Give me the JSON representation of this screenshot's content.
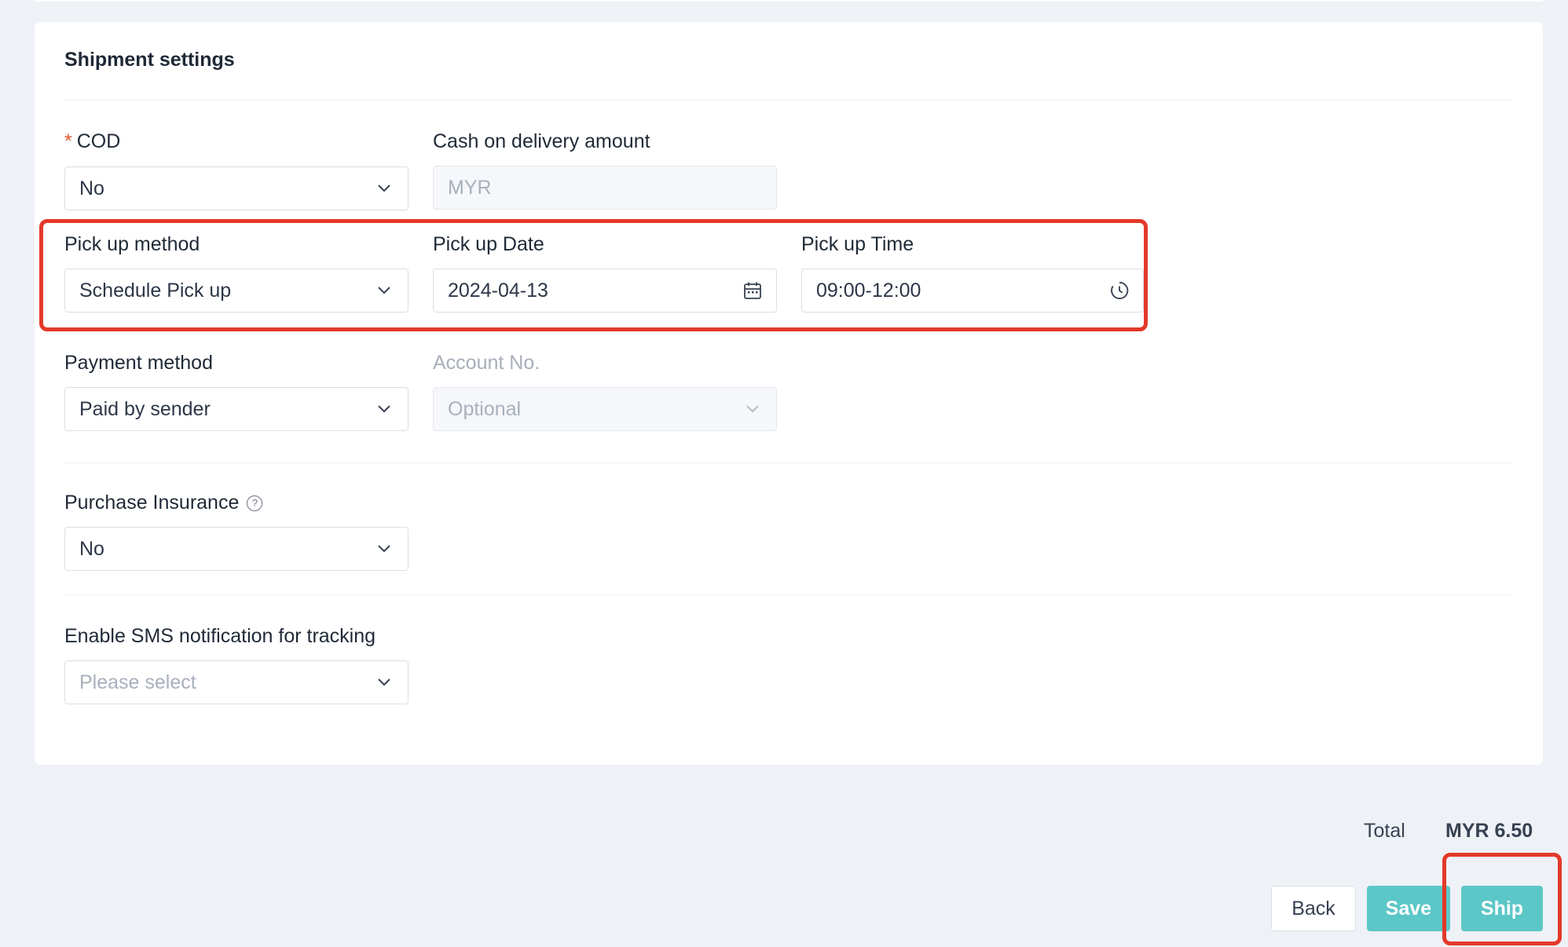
{
  "section": {
    "title": "Shipment settings"
  },
  "cod": {
    "label": "COD",
    "required_mark": "*",
    "value": "No"
  },
  "cod_amount": {
    "label": "Cash on delivery amount",
    "placeholder": "MYR"
  },
  "pickup_method": {
    "label": "Pick up method",
    "value": "Schedule Pick up"
  },
  "pickup_date": {
    "label": "Pick up Date",
    "value": "2024-04-13"
  },
  "pickup_time": {
    "label": "Pick up Time",
    "value": "09:00-12:00"
  },
  "payment_method": {
    "label": "Payment method",
    "value": "Paid by sender"
  },
  "account_no": {
    "label": "Account No.",
    "placeholder": "Optional"
  },
  "insurance": {
    "label": "Purchase Insurance",
    "help_glyph": "?",
    "value": "No"
  },
  "sms": {
    "label": "Enable SMS notification for tracking",
    "placeholder": "Please select"
  },
  "summary": {
    "total_label": "Total",
    "total_value": "MYR 6.50"
  },
  "actions": {
    "back": "Back",
    "save": "Save",
    "ship": "Ship"
  },
  "colors": {
    "accent": "#5cc7c7",
    "highlight": "#e3392a",
    "required": "#e4572e"
  },
  "icons": [
    "chevron-down-icon",
    "calendar-icon",
    "clock-icon",
    "help-circle-icon"
  ]
}
